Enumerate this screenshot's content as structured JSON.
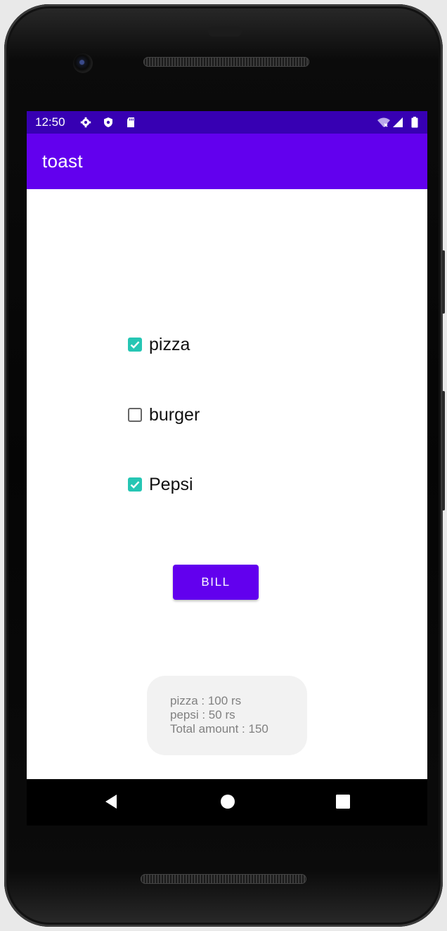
{
  "status_bar": {
    "time": "12:50",
    "color": "#3700b3"
  },
  "app_bar": {
    "title": "toast",
    "color": "#6200ee"
  },
  "checkboxes": [
    {
      "label": "pizza",
      "checked": true
    },
    {
      "label": "burger",
      "checked": false
    },
    {
      "label": "Pepsi",
      "checked": true
    }
  ],
  "bill_button": {
    "label": "BILL"
  },
  "toast": {
    "lines": [
      "pizza : 100 rs",
      "pepsi : 50 rs",
      "Total amount : 150"
    ]
  },
  "nav": {
    "back": "back-icon",
    "home": "home-icon",
    "recents": "recents-icon"
  },
  "colors": {
    "accent": "#6200ee",
    "checkbox_checked": "#26c6b4"
  }
}
